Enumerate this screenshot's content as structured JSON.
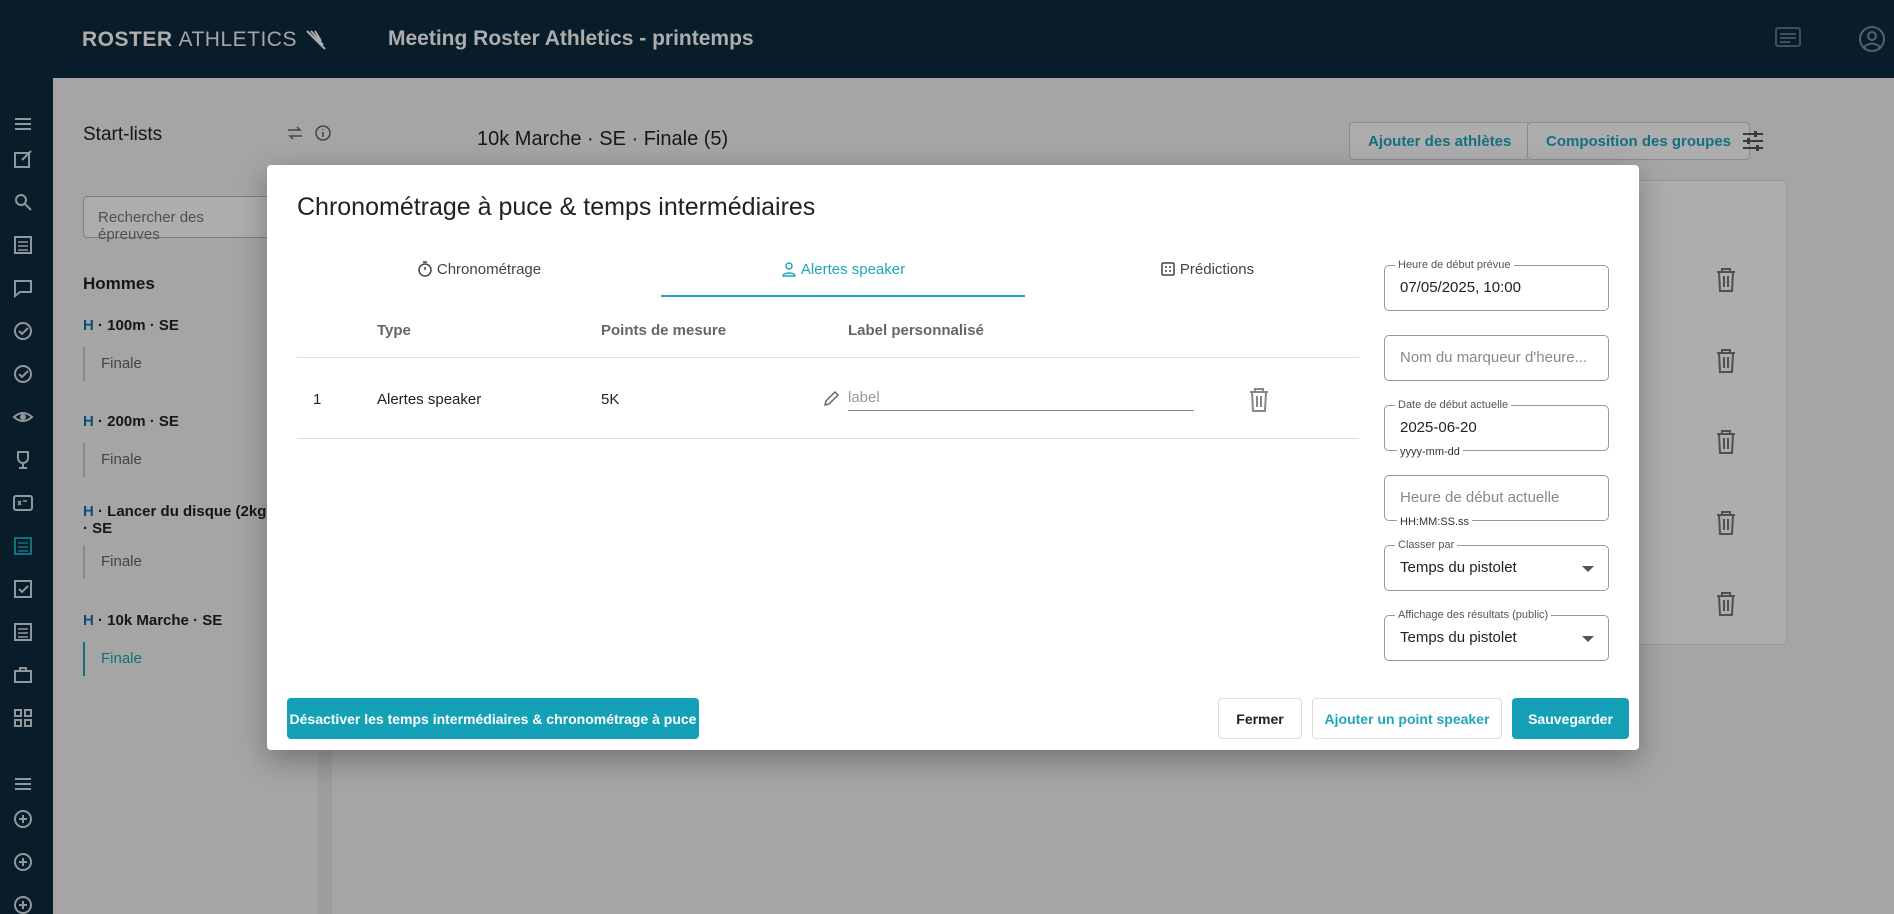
{
  "header": {
    "brand_bold": "ROSTER",
    "brand_light": "ATHLETICS",
    "title": "Meeting Roster Athletics - printemps",
    "icons": [
      "chat-icon",
      "account-icon"
    ]
  },
  "rail": {
    "icons": [
      "menu-icon",
      "edit-icon",
      "search-icon",
      "list-icon",
      "chat-icon",
      "check-circle-icon",
      "check-circle-icon",
      "eye-icon",
      "trophy-icon",
      "xyz-icon",
      "startlist-icon",
      "checkbox-icon",
      "list-icon",
      "briefcase-icon",
      "apps-icon",
      "menu-icon",
      "plus-circle-icon",
      "plus-circle-icon",
      "plus-circle-icon"
    ]
  },
  "sidebar": {
    "title": "Start-lists",
    "search_placeholder": "Rechercher des épreuves",
    "group": "Hommes",
    "events": [
      {
        "prefix": "H",
        "name": " · 100m · SE",
        "sub": "Finale"
      },
      {
        "prefix": "H",
        "name": " · 200m · SE",
        "sub": "Finale"
      },
      {
        "prefix": "H",
        "name": " · Lancer du disque (2kg) · SE",
        "sub": "Finale"
      },
      {
        "prefix": "H",
        "name": " · 10k Marche · SE",
        "sub": "Finale"
      }
    ]
  },
  "main": {
    "header": "10k Marche · SE · Finale (5)",
    "add_athletes": "Ajouter des athlètes",
    "group_composition": "Composition des groupes"
  },
  "modal": {
    "title": "Chronométrage à puce & temps intermédiaires",
    "tabs": [
      {
        "label": "Chronométrage",
        "icon": "stopwatch-icon"
      },
      {
        "label": "Alertes speaker",
        "icon": "person-icon",
        "active": true
      },
      {
        "label": "Prédictions",
        "icon": "calculator-icon"
      }
    ],
    "table": {
      "headers": [
        "Type",
        "Points de mesure",
        "Label personnalisé"
      ],
      "rows": [
        {
          "index": "1",
          "type": "Alertes speaker",
          "point": "5K",
          "label_value": "",
          "label_placeholder": "label"
        }
      ]
    },
    "fields": {
      "planned_start": {
        "label": "Heure de début prévue",
        "value": "07/05/2025, 10:00"
      },
      "marker_name": {
        "placeholder": "Nom du marqueur d'heure..."
      },
      "actual_date": {
        "label": "Date de début actuelle",
        "value": "2025-06-20",
        "helper": "yyyy-mm-dd"
      },
      "actual_time": {
        "placeholder": "Heure de début actuelle",
        "helper": "HH:MM:SS.ss"
      },
      "sort_by": {
        "label": "Classer par",
        "value": "Temps du pistolet"
      },
      "results_display": {
        "label": "Affichage des résultats (public)",
        "value": "Temps du pistolet"
      }
    },
    "buttons": {
      "disable": "Désactiver les temps intermédiaires & chronométrage à puce",
      "close": "Fermer",
      "add_speaker": "Ajouter un point speaker",
      "save": "Sauvegarder"
    }
  },
  "colors": {
    "accent": "#1ea6bd",
    "topbar": "#0e2a3f",
    "primary_button": "#14a1b7"
  }
}
